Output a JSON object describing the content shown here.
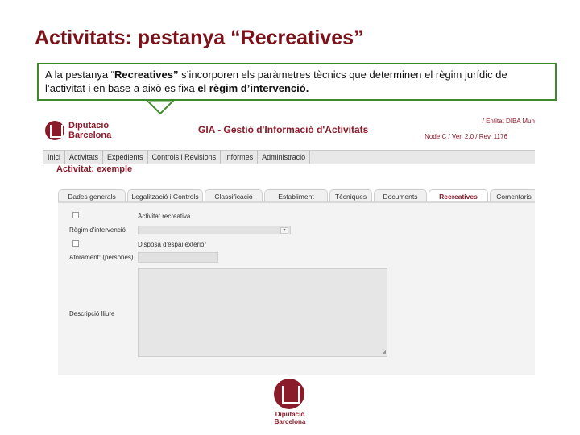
{
  "slide": {
    "title": "Activitats: pestanya “Recreatives”"
  },
  "callout": {
    "text_1": "A la pestanya “",
    "text_2": "Recreatives”",
    "text_3": " s’incorporen els paràmetres tècnics que determinen el règim jurídic de l’activitat i en base a això es fixa ",
    "text_4": "el règim d’intervenció.",
    "border_color": "#3d8a2a"
  },
  "app": {
    "logo_line1": "Diputació",
    "logo_line2": "Barcelona",
    "title": "GIA - Gestió d'Informació d'Activitats",
    "user": "/ Entitat DIBA Mun",
    "version": "Node C / Ver. 2.0 / Rev. 1176",
    "brand_color": "#8a1b2a"
  },
  "menu": [
    "Inici",
    "Activitats",
    "Expedients",
    "Controls i Revisions",
    "Informes",
    "Administració"
  ],
  "activity_title": "Activitat: exemple",
  "tabs": [
    "Dades generals",
    "Legalització i Controls",
    "Classificació",
    "Establiment",
    "Tècniques",
    "Documents",
    "Recreatives",
    "Comentaris"
  ],
  "active_tab": "Recreatives",
  "form": {
    "activitat_recreativa": "Activitat recreativa",
    "regim_intervencio": "Règim d'intervenció",
    "disposa_espai_exterior": "Disposa d'espai exterior",
    "aforament": "Aforament: (persones)",
    "descripcio_lliure": "Descripció lliure"
  },
  "footer": {
    "logo_line1": "Diputació",
    "logo_line2": "Barcelona"
  }
}
